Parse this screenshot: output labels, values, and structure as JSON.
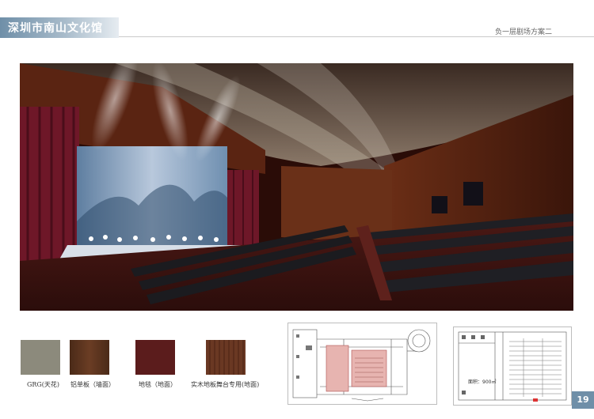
{
  "header": {
    "title": "深圳市南山文化馆",
    "subtitle": "负一层剧场方案二"
  },
  "materials": [
    {
      "label": "GRG(天花)",
      "color": "#8c8a7c"
    },
    {
      "label": "铝单板（墙面）",
      "color": "#5a3320"
    },
    {
      "label": "地毯（地面）",
      "color": "#5b1c1c"
    },
    {
      "label": "实木地板舞台专用(地面)",
      "color": "#6a3823"
    }
  ],
  "plan_right": {
    "area_label": "面积：900㎡"
  },
  "footer": {
    "page_number": "19"
  },
  "colors": {
    "accent": "#6f8fa8"
  }
}
